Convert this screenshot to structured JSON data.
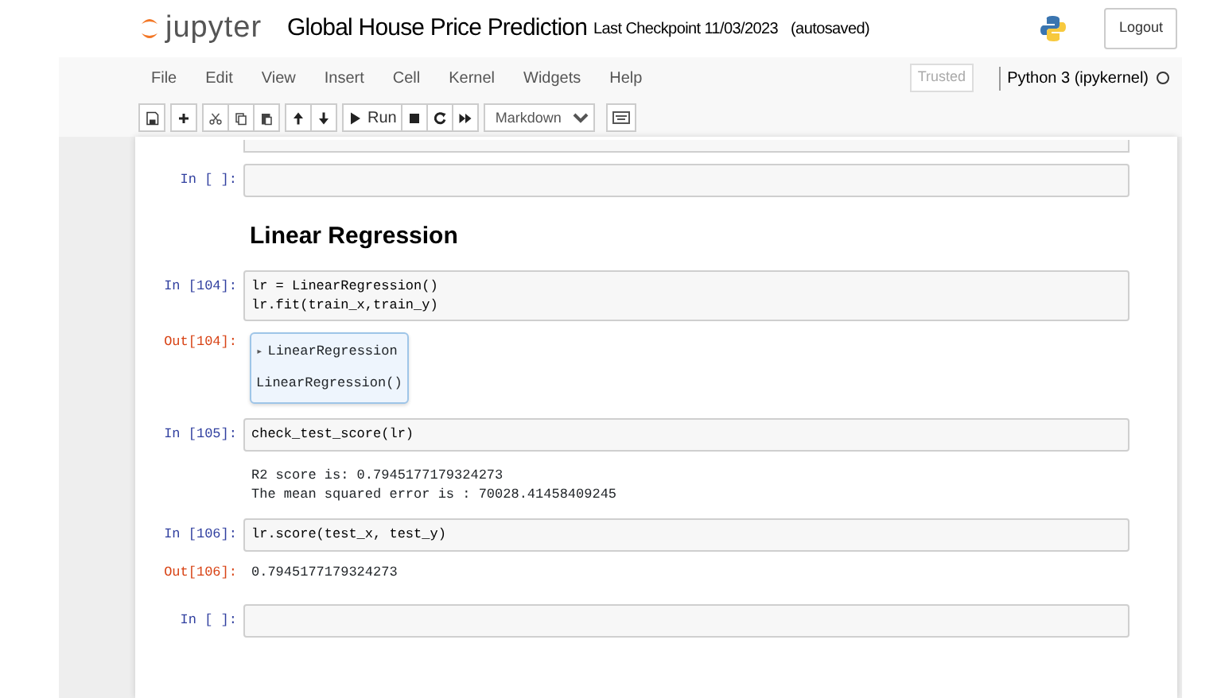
{
  "header": {
    "logo_text": "jupyter",
    "title": "Global House Price Prediction",
    "checkpoint": "Last Checkpoint 11/03/2023",
    "autosave": "(autosaved)",
    "logout": "Logout"
  },
  "menu": {
    "items": [
      "File",
      "Edit",
      "View",
      "Insert",
      "Cell",
      "Kernel",
      "Widgets",
      "Help"
    ],
    "trusted": "Trusted",
    "kernel": "Python 3 (ipykernel)"
  },
  "toolbar": {
    "buttons": [
      {
        "kind": "save"
      },
      {
        "kind": "add"
      },
      {
        "kind": "cut"
      },
      {
        "kind": "copy"
      },
      {
        "kind": "paste"
      },
      {
        "kind": "up"
      },
      {
        "kind": "down"
      },
      {
        "kind": "run",
        "label": "Run"
      },
      {
        "kind": "stop"
      },
      {
        "kind": "restart"
      },
      {
        "kind": "fastforward"
      }
    ],
    "cell_type": "Markdown"
  },
  "cells": [
    {
      "kind": "partial"
    },
    {
      "kind": "code",
      "prompt": "In [ ]:"
    },
    {
      "kind": "heading",
      "text": "Linear Regression"
    },
    {
      "kind": "code",
      "prompt": "In [104]:",
      "lines": [
        "lr = LinearRegression()",
        "lr.fit(train_x,train_y)"
      ],
      "outputs": [
        {
          "kind": "widget",
          "prompt": "Out[104]:",
          "toggle": "▸",
          "label": "LinearRegression",
          "repr": "LinearRegression()"
        }
      ]
    },
    {
      "kind": "code",
      "prompt": "In [105]:",
      "lines": [
        "check_test_score(lr)"
      ],
      "outputs": [
        {
          "kind": "stream",
          "lines": [
            "R2 score is: 0.7945177179324273",
            "The mean squared error is : 70028.41458409245"
          ]
        }
      ]
    },
    {
      "kind": "code",
      "prompt": "In [106]:",
      "lines": [
        "lr.score(test_x, test_y)"
      ],
      "outputs": [
        {
          "kind": "result",
          "prompt": "Out[106]:",
          "text": "0.7945177179324273"
        }
      ]
    },
    {
      "kind": "code",
      "prompt": "In [ ]:"
    }
  ]
}
